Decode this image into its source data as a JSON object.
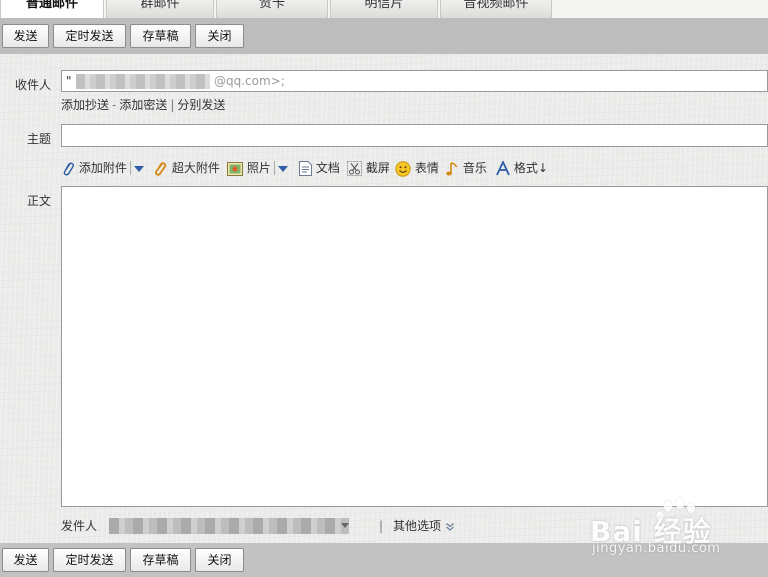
{
  "tabs": [
    {
      "label": "普通邮件",
      "active": true
    },
    {
      "label": "群邮件",
      "active": false
    },
    {
      "label": "贺卡",
      "active": false
    },
    {
      "label": "明信片",
      "active": false
    },
    {
      "label": "音视频邮件",
      "active": false
    }
  ],
  "toolbar": {
    "send_label": "发送",
    "scheduled_send_label": "定时发送",
    "save_draft_label": "存草稿",
    "close_label": "关闭"
  },
  "recipient": {
    "label": "收件人",
    "value_prefix": "\"",
    "value_suffix": "@qq.com>;"
  },
  "cc_links": {
    "add_cc": "添加抄送",
    "dash": "-",
    "add_bcc": "添加密送",
    "pipe": "|",
    "separate_send": "分别发送"
  },
  "subject": {
    "label": "主题",
    "value": ""
  },
  "attach_toolbar": {
    "add_attachment": "添加附件",
    "large_attachment": "超大附件",
    "photo": "照片",
    "document": "文档",
    "screenshot": "截屏",
    "emoji": "表情",
    "music": "音乐",
    "format": "格式↓"
  },
  "body": {
    "label": "正文",
    "value": ""
  },
  "sender": {
    "label": "发件人",
    "pipe": "|",
    "other_options": "其他选项"
  },
  "watermark": {
    "text": "Bai 经验",
    "subtext": "jingyan.baidu.com"
  },
  "colors": {
    "toolbar_bg": "#bdbdbd",
    "link_blue": "#2d5fa6",
    "page_bg": "#ebebea"
  }
}
